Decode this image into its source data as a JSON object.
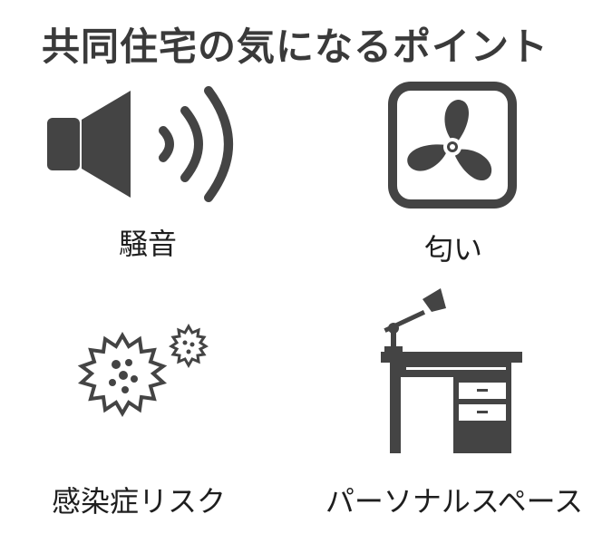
{
  "title": "共同住宅の気になるポイント",
  "items": [
    {
      "label": "騒音",
      "icon": "speaker-icon"
    },
    {
      "label": "匂い",
      "icon": "fan-icon"
    },
    {
      "label": "感染症リスク",
      "icon": "virus-icon"
    },
    {
      "label": "パーソナルスペース",
      "icon": "desk-lamp-icon"
    }
  ],
  "colors": {
    "icon": "#444444",
    "text": "#1e1e1e"
  }
}
